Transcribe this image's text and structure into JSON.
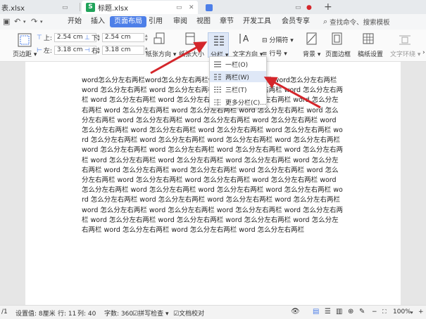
{
  "tabs": [
    {
      "label": "表.xlsx"
    },
    {
      "label": "标题.xlsx",
      "icon": "S"
    },
    {
      "label": ""
    }
  ],
  "menu": [
    "开始",
    "插入",
    "页面布局",
    "引用",
    "审阅",
    "视图",
    "章节",
    "开发工具",
    "会员专享"
  ],
  "search_placeholder": "查找命令、搜索模板",
  "ribbon": {
    "margin_label": "页边距",
    "top_label": "上:",
    "top_value": "2.54 cm",
    "bottom_label": "下:",
    "bottom_value": "2.54 cm",
    "left_label": "左:",
    "left_value": "3.18 cm",
    "right_label": "右:",
    "right_value": "3.18 cm",
    "orientation": "纸张方向",
    "size": "纸张大小",
    "columns": "分栏",
    "text_direction": "文字方向",
    "separator": "分隔符",
    "line_number": "行号",
    "background": "背景",
    "page_border": "页面边框",
    "manuscript": "稿纸设置",
    "wrap": "文字环绕"
  },
  "dropdown": [
    "一栏(O)",
    "两栏(W)",
    "三栏(T)",
    "更多分栏(C)..."
  ],
  "doc_text": "word怎么分左右两栏word怎么分左右两栏word怎么分左右两栏 word怎么分左右两栏 word 怎么分左右两栏 word 怎么分左右两栏 word 怎么分左右两栏 word 怎么分左右两栏 word 怎么分左右两栏 word 怎么分左右两栏 word 怎么分左右两栏 word 怎么分左右两栏 word 怎么分左右两栏 word 怎么分左右两栏 word 怎么分左右两栏 word 怎么分左右两栏 word 怎么分左右两栏 word 怎么分左右两栏 word 怎么分左右两栏 word 怎么分左右两栏 word 怎么分左右两栏 word 怎么分左右两栏 word 怎么分左右两栏 word 怎么分左右两栏 word 怎么分左右两栏 word 怎么分左右两栏 word 怎么分左右两栏 word 怎么分左右两栏 word 怎么分左右两栏 word 怎么分左右两栏 word 怎么分左右两栏 word 怎么分左右两栏 word 怎么分左右两栏 word 怎么分左右两栏 word 怎么分左右两栏 word 怎么分左右两栏 word 怎么分左右两栏 word 怎么分左右两栏 word 怎么分左右两栏 word 怎么分左右两栏 word 怎么分左右两栏 word 怎么分左右两栏 word 怎么分左右两栏 word 怎么分左右两栏 word 怎么分左右两栏 word 怎么分左右两栏 word 怎么分左右两栏 word 怎么分左右两栏 word 怎么分左右两栏 word 怎么分左右两栏 word 怎么分左右两栏 word 怎么分左右两栏 word 怎么分左右两栏 word 怎么分左右两栏 word 怎么分左右两栏 word 怎么分左右两栏 word 怎么分左右两栏 word 怎么分左右两栏 word 怎么分左右两栏 word 怎么分左右两栏 word 怎么分左右两栏",
  "status": {
    "page": "/1",
    "setting": "设置值: 8厘米",
    "row": "行: 11",
    "col": "列: 40",
    "chars": "字数: 360",
    "spell": "拼写检查",
    "proof": "文档校对",
    "zoom": "100%"
  },
  "colors": {
    "accent": "#4d7fe8",
    "arrow": "#d4262b",
    "sheet_icon": "#20a35a"
  }
}
